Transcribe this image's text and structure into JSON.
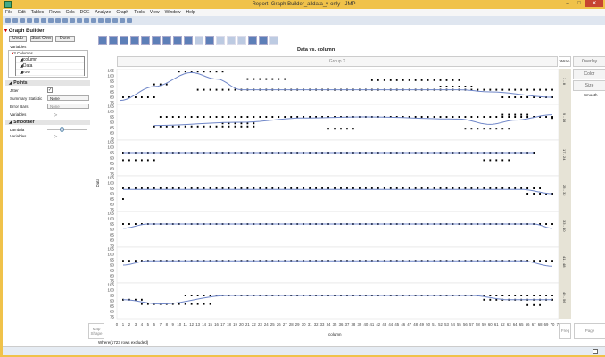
{
  "window": {
    "title": "Report: Graph Builder_alldata_y-only - JMP"
  },
  "menu": [
    "File",
    "Edit",
    "Tables",
    "Rows",
    "Cols",
    "DOE",
    "Analyze",
    "Graph",
    "Tools",
    "View",
    "Window",
    "Help"
  ],
  "panel": {
    "title": "Graph Builder",
    "undo": "Undo",
    "start_over": "Start Over",
    "done": "Done",
    "variables_label": "Variables",
    "columns_header": "3 Columns",
    "columns": [
      "column",
      "Data",
      "row"
    ],
    "points_section": "Points",
    "jitter_label": "Jitter",
    "jitter_checked": true,
    "summary_label": "Summary Statistic",
    "summary_value": "None",
    "error_label": "Error Bars",
    "error_value": "None",
    "variables_row": "Variables",
    "smoother_section": "Smoother",
    "lambda_label": "Lambda",
    "lambda_value": 0.4,
    "variables_row2": "Variables"
  },
  "chart": {
    "title": "Data vs. column",
    "group_x": "Group X",
    "wrap": "Wrap",
    "overlay": "Overlay",
    "color": "Color",
    "size": "Size",
    "legend": "Smooth",
    "ylabel": "Data",
    "xlabel": "column",
    "map_shape": "Map Shape",
    "freq": "Freq",
    "page": "Page",
    "where": "Where(1723 rows excluded)"
  },
  "chart_data": {
    "type": "scatter",
    "title": "Data vs. column",
    "xlabel": "column",
    "ylabel": "Data",
    "xlim": [
      0,
      71
    ],
    "ylim": [
      75,
      105
    ],
    "yticks": [
      75,
      80,
      85,
      90,
      95,
      100,
      105
    ],
    "panels": [
      {
        "label": "1 - 8",
        "smooth": [
          [
            0.5,
            77
          ],
          [
            6,
            90
          ],
          [
            12,
            103
          ],
          [
            16,
            97
          ],
          [
            20,
            87
          ],
          [
            55,
            87
          ],
          [
            60,
            85
          ],
          [
            70,
            80
          ]
        ],
        "dot_rows": [
          [
            1,
            6,
            80
          ],
          [
            6,
            8,
            92
          ],
          [
            10,
            17,
            104
          ],
          [
            13,
            70,
            87
          ],
          [
            21,
            27,
            97
          ],
          [
            41,
            55,
            96
          ],
          [
            52,
            57,
            90
          ],
          [
            62,
            70,
            80
          ]
        ]
      },
      {
        "label": "9 - 16",
        "smooth": [
          [
            6,
            87
          ],
          [
            20,
            90
          ],
          [
            30,
            94
          ],
          [
            40,
            95
          ],
          [
            55,
            93
          ],
          [
            60,
            88
          ],
          [
            64,
            92
          ],
          [
            70,
            97
          ]
        ],
        "dot_rows": [
          [
            6,
            22,
            86
          ],
          [
            7,
            70,
            95
          ],
          [
            17,
            22,
            89
          ],
          [
            34,
            38,
            84
          ],
          [
            56,
            63,
            84
          ],
          [
            62,
            66,
            97
          ],
          [
            70,
            70,
            94
          ]
        ]
      },
      {
        "label": "17 - 24",
        "smooth": [
          [
            1,
            95
          ],
          [
            67,
            95
          ]
        ],
        "dot_rows": [
          [
            1,
            67,
            95
          ],
          [
            1,
            6,
            88
          ],
          [
            59,
            63,
            88
          ]
        ]
      },
      {
        "label": "25 - 32",
        "smooth": [
          [
            1,
            94
          ],
          [
            65,
            94
          ],
          [
            70,
            90
          ]
        ],
        "dot_rows": [
          [
            1,
            68,
            95
          ],
          [
            1,
            1,
            85
          ],
          [
            66,
            70,
            90
          ]
        ]
      },
      {
        "label": "33 - 40",
        "smooth": [
          [
            1,
            91
          ],
          [
            5,
            95
          ],
          [
            67,
            95
          ],
          [
            70,
            91
          ]
        ],
        "dot_rows": [
          [
            1,
            70,
            95
          ]
        ]
      },
      {
        "label": "41 - 48",
        "smooth": [
          [
            1,
            90
          ],
          [
            5,
            94
          ],
          [
            65,
            94
          ],
          [
            70,
            89
          ]
        ],
        "dot_rows": [
          [
            1,
            70,
            94
          ]
        ]
      },
      {
        "label": "49 - 56",
        "smooth": [
          [
            1,
            91
          ],
          [
            7,
            87
          ],
          [
            18,
            95
          ],
          [
            57,
            95
          ],
          [
            63,
            91
          ],
          [
            70,
            91
          ]
        ],
        "dot_rows": [
          [
            11,
            62,
            95
          ],
          [
            1,
            4,
            91
          ],
          [
            4,
            15,
            87
          ],
          [
            18,
            70,
            95
          ],
          [
            59,
            70,
            91
          ],
          [
            66,
            68,
            86
          ]
        ]
      }
    ]
  },
  "colors": {
    "smooth": "#6f86c8",
    "dot": "#000000"
  }
}
